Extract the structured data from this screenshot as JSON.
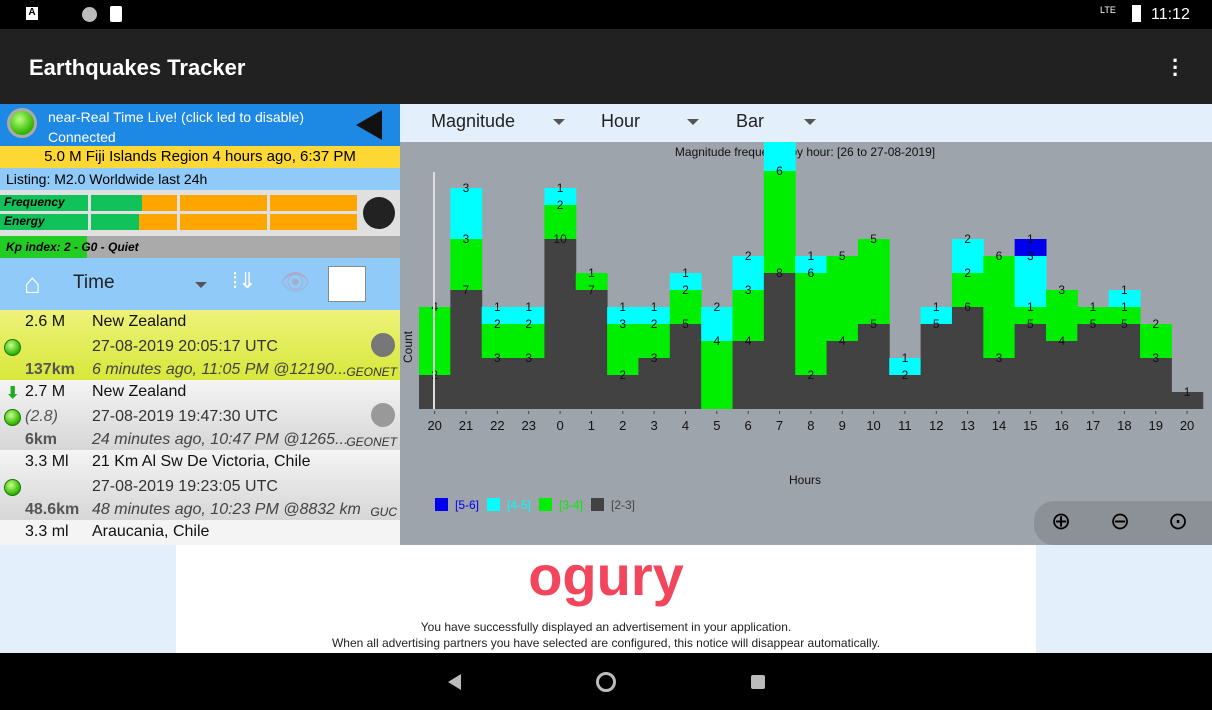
{
  "status_bar": {
    "time": "11:12",
    "network": "LTE"
  },
  "app": {
    "title": "Earthquakes Tracker",
    "menu_icon": "more-vert-icon"
  },
  "live": {
    "line1": "near-Real Time Live! (click led to disable)",
    "line2": "Connected"
  },
  "alert": "5.0 M Fiji Islands Region 4 hours ago, 6:37 PM",
  "listing": "Listing: M2.0 Worldwide last 24h",
  "meters": {
    "frequency_label": "Frequency",
    "energy_label": "Energy",
    "kp_label": "Kp index: 2 - G0 - Quiet",
    "frequency_level": 0.2,
    "energy_level": 0.19,
    "kp_level": 0.22
  },
  "sort": {
    "selected": "Time"
  },
  "quakes": [
    {
      "mag": "2.6 M",
      "place": "New Zealand",
      "utc": "27-08-2019 20:05:17 UTC",
      "depth": "137km",
      "ago": "6 minutes ago, 11:05 PM @12190...",
      "source": "GEONET",
      "highlight": true
    },
    {
      "mag": "2.7 M",
      "place": "New Zealand",
      "utc": "27-08-2019 19:47:30 UTC",
      "depth": "6km",
      "ago": "24 minutes ago, 10:47 PM @1265...",
      "source": "GEONET",
      "sub": "(2.8)"
    },
    {
      "mag": "3.3 Ml",
      "place": "21 Km Al Sw De Victoria, Chile",
      "utc": "27-08-2019 19:23:05 UTC",
      "depth": "48.6km",
      "ago": "48 minutes ago, 10:23 PM @8832 km",
      "source": "GUC"
    },
    {
      "mag": "3.3 ml",
      "place": "Araucania, Chile"
    }
  ],
  "chart_controls": {
    "variable": "Magnitude",
    "grouping": "Hour",
    "type": "Bar"
  },
  "chart_data": {
    "type": "bar",
    "stacked": true,
    "title": "Magnitude frequency by hour: [26 to 27-08-2019]",
    "xlabel": "Hours",
    "ylabel": "Count",
    "ylim": [
      0,
      16
    ],
    "categories": [
      "20",
      "21",
      "22",
      "23",
      "0",
      "1",
      "2",
      "3",
      "4",
      "5",
      "6",
      "7",
      "8",
      "9",
      "10",
      "11",
      "12",
      "13",
      "14",
      "15",
      "16",
      "17",
      "18",
      "19",
      "20"
    ],
    "series": [
      {
        "name": "[2-3]",
        "color": "#424242",
        "values": [
          2,
          7,
          3,
          3,
          10,
          7,
          2,
          3,
          5,
          0,
          4,
          8,
          2,
          4,
          5,
          2,
          5,
          6,
          3,
          5,
          4,
          5,
          5,
          3,
          1
        ]
      },
      {
        "name": "[3-4]",
        "color": "#00ee00",
        "values": [
          4,
          3,
          2,
          2,
          2,
          1,
          3,
          2,
          2,
          4,
          3,
          6,
          6,
          5,
          5,
          0,
          0,
          2,
          6,
          1,
          3,
          1,
          1,
          2,
          0
        ]
      },
      {
        "name": "[4-5]",
        "color": "#00ffff",
        "values": [
          0,
          3,
          1,
          1,
          1,
          0,
          1,
          1,
          1,
          2,
          2,
          2,
          1,
          0,
          0,
          1,
          1,
          2,
          0,
          3,
          0,
          0,
          1,
          0,
          0
        ]
      },
      {
        "name": "[5-6]",
        "color": "#0000ee",
        "values": [
          0,
          0,
          0,
          0,
          0,
          0,
          0,
          0,
          0,
          0,
          0,
          0,
          0,
          0,
          0,
          0,
          0,
          0,
          0,
          1,
          0,
          0,
          0,
          0,
          0
        ]
      }
    ],
    "legend_position": "bottom-left"
  },
  "ad": {
    "brand": "ogury",
    "line1": "You have successfully displayed an advertisement in your application.",
    "line2": "When all advertising partners you have selected are configured, this notice will disappear automatically."
  }
}
